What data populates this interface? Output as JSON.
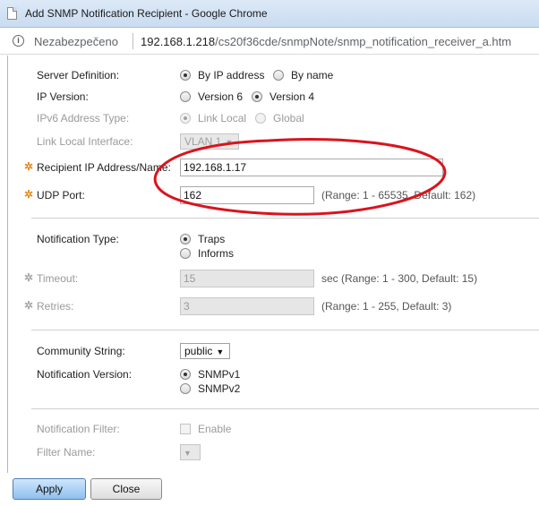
{
  "window": {
    "title": "Add SNMP Notification Recipient - Google Chrome"
  },
  "address_bar": {
    "security_text": "Nezabezpečeno",
    "url_host": "192.168.1.218",
    "url_path": "/cs20f36cde/snmpNote/snmp_notification_receiver_a.htm"
  },
  "form": {
    "server_definition": {
      "label": "Server Definition:",
      "options": [
        "By IP address",
        "By name"
      ],
      "selected": "By IP address"
    },
    "ip_version": {
      "label": "IP Version:",
      "options": [
        "Version 6",
        "Version 4"
      ],
      "selected": "Version 4"
    },
    "ipv6_address_type": {
      "label": "IPv6 Address Type:",
      "options": [
        "Link Local",
        "Global"
      ],
      "selected": "Link Local"
    },
    "link_local_interface": {
      "label": "Link Local Interface:",
      "value": "VLAN 1"
    },
    "recipient_ip": {
      "label": "Recipient IP Address/Name:",
      "value": "192.168.1.17"
    },
    "udp_port": {
      "label": "UDP Port:",
      "value": "162",
      "hint": "(Range: 1 - 65535, Default: 162)"
    },
    "notification_type": {
      "label": "Notification Type:",
      "options": [
        "Traps",
        "Informs"
      ],
      "selected": "Traps"
    },
    "timeout": {
      "label": "Timeout:",
      "value": "15",
      "hint": "sec (Range: 1 - 300, Default: 15)"
    },
    "retries": {
      "label": "Retries:",
      "value": "3",
      "hint": "(Range: 1 - 255, Default: 3)"
    },
    "community_string": {
      "label": "Community String:",
      "value": "public"
    },
    "notification_version": {
      "label": "Notification Version:",
      "options": [
        "SNMPv1",
        "SNMPv2"
      ],
      "selected": "SNMPv1"
    },
    "notification_filter": {
      "label": "Notification Filter:",
      "checkbox_label": "Enable"
    },
    "filter_name": {
      "label": "Filter Name:"
    }
  },
  "buttons": {
    "apply": "Apply",
    "close": "Close"
  },
  "colors": {
    "required_marker": "#e88a1a",
    "annotation_ellipse": "#d9141e"
  },
  "icons": {
    "required": "asterisk-gear",
    "security": "info-circle",
    "dropdown": "triangle-down"
  }
}
